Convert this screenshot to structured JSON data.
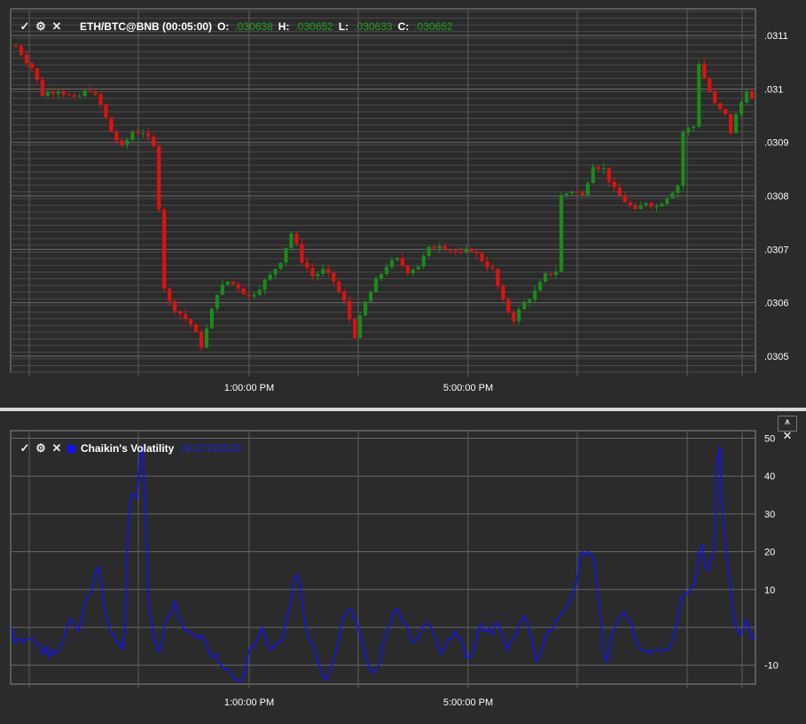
{
  "price_chart": {
    "symbol": "ETH/BTC@BNB (00:05:00)",
    "ohlc": [
      {
        "label": "O:",
        "value": ".030638"
      },
      {
        "label": "H:",
        "value": ".030652"
      },
      {
        "label": "L:",
        "value": ".030633"
      },
      {
        "label": "C:",
        "value": ".030652"
      }
    ],
    "colors": {
      "up": "#1a8a1a",
      "down": "#e01010",
      "grid": "#5a5a5a",
      "frame": "#888888"
    }
  },
  "indicator": {
    "name": "Chaikin's Volatility",
    "value": "29.87293528",
    "color": "#1010ff",
    "pin_label": "⩚",
    "close_label": "✕"
  },
  "controls": {
    "check_icon": "✓",
    "gear_icon": "⚙",
    "close_icon": "✕"
  },
  "chart_data": [
    {
      "type": "candlestick",
      "title": "ETH/BTC@BNB (00:05:00)",
      "y_ticks": [
        ".0311",
        ".031",
        ".0309",
        ".0308",
        ".0307",
        ".0306",
        ".0305"
      ],
      "ylim": [
        0.03047,
        0.03115
      ],
      "x_ticks": [
        "1:00:00 PM",
        "5:00:00 PM"
      ],
      "grid": true,
      "close_path": [
        [
          0,
          0.03108
        ],
        [
          3,
          0.03104
        ],
        [
          5,
          0.03099
        ],
        [
          8,
          0.031
        ],
        [
          11,
          0.03098
        ],
        [
          14,
          0.031
        ],
        [
          16,
          0.03097
        ],
        [
          18,
          0.03092
        ],
        [
          20,
          0.03089
        ],
        [
          22,
          0.03092
        ],
        [
          24,
          0.03092
        ],
        [
          26,
          0.03089
        ],
        [
          27,
          0.03078
        ],
        [
          28,
          0.03063
        ],
        [
          29,
          0.0306
        ],
        [
          31,
          0.03058
        ],
        [
          33,
          0.03056
        ],
        [
          35,
          0.03052
        ],
        [
          36,
          0.03055
        ],
        [
          38,
          0.03062
        ],
        [
          40,
          0.03064
        ],
        [
          42,
          0.03063
        ],
        [
          44,
          0.03061
        ],
        [
          46,
          0.03063
        ],
        [
          48,
          0.03065
        ],
        [
          50,
          0.03068
        ],
        [
          52,
          0.03073
        ],
        [
          54,
          0.03068
        ],
        [
          56,
          0.03065
        ],
        [
          58,
          0.03066
        ],
        [
          60,
          0.03064
        ],
        [
          62,
          0.0306
        ],
        [
          64,
          0.03054
        ],
        [
          66,
          0.0306
        ],
        [
          68,
          0.03064
        ],
        [
          70,
          0.03067
        ],
        [
          72,
          0.03068
        ],
        [
          74,
          0.03066
        ],
        [
          76,
          0.03067
        ],
        [
          78,
          0.0307
        ],
        [
          80,
          0.03071
        ],
        [
          82,
          0.0307
        ],
        [
          84,
          0.03069
        ],
        [
          86,
          0.0307
        ],
        [
          88,
          0.03068
        ],
        [
          90,
          0.03066
        ],
        [
          92,
          0.0306
        ],
        [
          94,
          0.03057
        ],
        [
          96,
          0.0306
        ],
        [
          98,
          0.03062
        ],
        [
          100,
          0.03065
        ],
        [
          102,
          0.03066
        ],
        [
          103,
          0.0308
        ],
        [
          105,
          0.03081
        ],
        [
          107,
          0.0308
        ],
        [
          109,
          0.03086
        ],
        [
          111,
          0.03085
        ],
        [
          113,
          0.03081
        ],
        [
          115,
          0.03079
        ],
        [
          117,
          0.03077
        ],
        [
          119,
          0.03079
        ],
        [
          121,
          0.03078
        ],
        [
          123,
          0.0308
        ],
        [
          125,
          0.03082
        ],
        [
          126,
          0.03092
        ],
        [
          128,
          0.03093
        ],
        [
          129,
          0.03105
        ],
        [
          130,
          0.03102
        ],
        [
          132,
          0.03097
        ],
        [
          134,
          0.03095
        ],
        [
          135,
          0.03092
        ],
        [
          136,
          0.03095
        ],
        [
          138,
          0.031
        ],
        [
          139,
          0.03098
        ]
      ]
    },
    {
      "type": "line",
      "title": "Chaikin's Volatility",
      "series": [
        {
          "name": "Chaikin's Volatility",
          "color": "#1010ff",
          "values": [
            0,
            -4,
            -3,
            -3,
            -4,
            -3,
            -3,
            -3,
            -4,
            -4,
            -6,
            -7,
            -5,
            -8,
            -6,
            -7,
            -6,
            -5,
            -3,
            0,
            2,
            2,
            0,
            -1,
            2,
            6,
            8,
            9,
            11,
            15,
            16,
            10,
            4,
            1,
            -1,
            -2,
            -4,
            -4,
            -6,
            0,
            27,
            35,
            35,
            34,
            45,
            48,
            30,
            7,
            1,
            -3,
            -6,
            -6,
            -2,
            2,
            3,
            4,
            7,
            4,
            2,
            0,
            -1,
            -1,
            -2,
            -2,
            -3,
            -2,
            -3,
            -5,
            -7,
            -8,
            -7,
            -9,
            -10,
            -11,
            -11,
            -12,
            -13,
            -14,
            -14,
            -14,
            -12,
            -8,
            -5,
            -5,
            -4,
            -2,
            0,
            -2,
            -5,
            -6,
            -5,
            -4,
            -4,
            -3,
            1,
            4,
            7,
            13,
            14,
            12,
            5,
            0,
            -3,
            -4,
            -6,
            -9,
            -11,
            -13,
            -14,
            -12,
            -10,
            -7,
            -4,
            0,
            3,
            4,
            5,
            4,
            2,
            0,
            -3,
            -6,
            -9,
            -11,
            -12,
            -11,
            -10,
            -6,
            -3,
            -1,
            1,
            4,
            5,
            4,
            2,
            1,
            0,
            -3,
            -4,
            -3,
            -2,
            0,
            1,
            1,
            0,
            -2,
            -4,
            -7,
            -6,
            -5,
            -3,
            -3,
            -1,
            -2,
            -3,
            -5,
            -8,
            -8,
            -7,
            -5,
            -1,
            1,
            -1,
            -1,
            0,
            -2,
            1,
            1,
            -1,
            -4,
            -6,
            -4,
            -3,
            -2,
            0,
            2,
            3,
            1,
            -2,
            -5,
            -9,
            -8,
            -6,
            -3,
            -1,
            -1,
            0,
            2,
            3,
            4,
            5,
            6,
            8,
            10,
            12,
            18,
            20,
            19,
            20,
            19,
            18,
            10,
            4,
            -5,
            -9,
            -7,
            -2,
            0,
            2,
            3,
            4,
            3,
            2,
            0,
            -3,
            -5,
            -6,
            -6,
            -6,
            -7,
            -6,
            -6,
            -6,
            -6,
            -6,
            -6,
            -5,
            -3,
            0,
            4,
            8,
            9,
            9,
            10,
            11,
            14,
            20,
            22,
            16,
            15,
            18,
            20,
            42,
            48,
            30,
            22,
            15,
            8,
            2,
            -1,
            -2,
            -1,
            2,
            0,
            -3,
            -2
          ]
        }
      ],
      "y_ticks": [
        "50",
        "40",
        "30",
        "20",
        "10",
        "-10"
      ],
      "ylim": [
        -15,
        52
      ],
      "x_ticks": [
        "1:00:00 PM",
        "5:00:00 PM"
      ],
      "grid": true
    }
  ]
}
